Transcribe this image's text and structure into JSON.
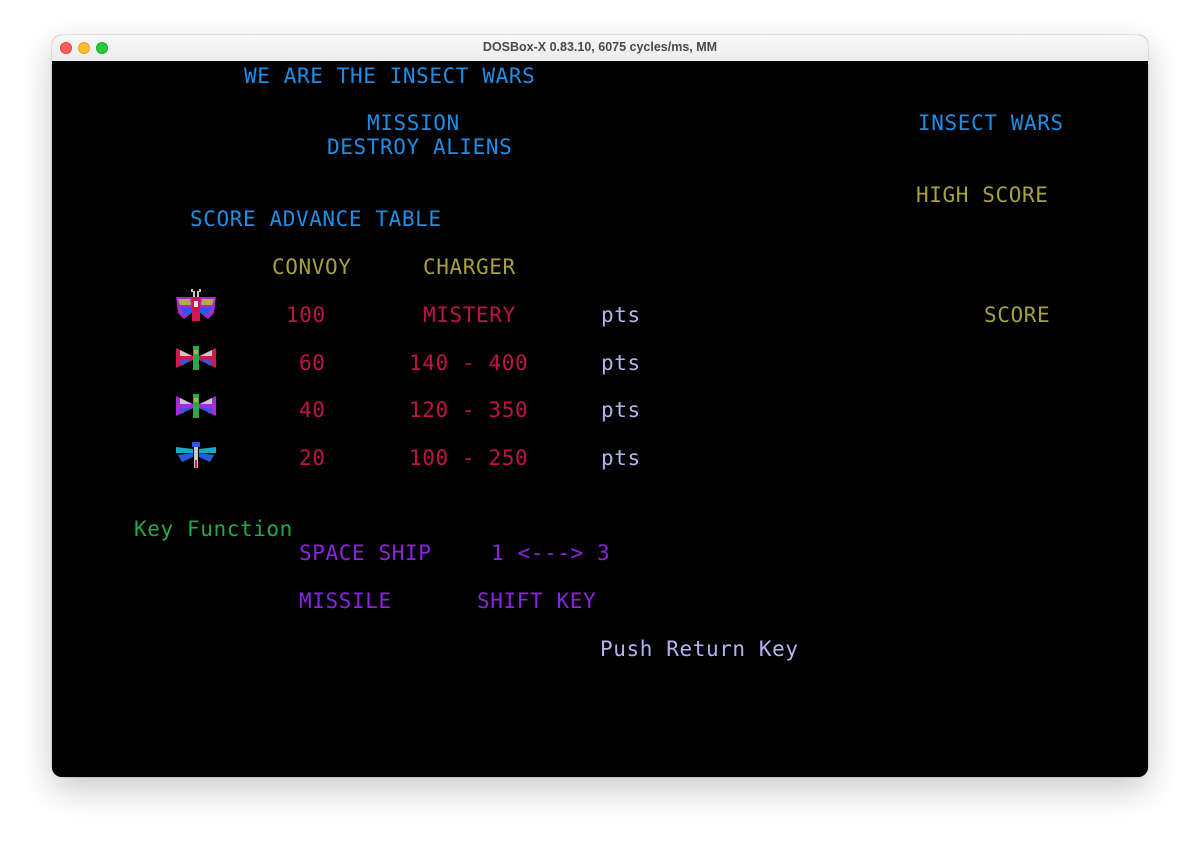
{
  "window": {
    "title": "DOSBox-X 0.83.10, 6075 cycles/ms, MM"
  },
  "screen": {
    "intro": "WE ARE THE INSECT WARS",
    "mission_heading": "MISSION",
    "mission_text": "DESTROY ALIENS",
    "game_name": "INSECT WARS",
    "high_score_label": "HIGH SCORE",
    "score_label": "SCORE",
    "score_table_title": "SCORE ADVANCE TABLE",
    "columns": {
      "convoy": "CONVOY",
      "charger": "CHARGER"
    },
    "rows": [
      {
        "insect": "flagship-insect-icon",
        "convoy": "100",
        "charger": "MISTERY",
        "unit": "pts"
      },
      {
        "insect": "red-moth-insect-icon",
        "convoy": "60",
        "charger": "140 - 400",
        "unit": "pts"
      },
      {
        "insect": "purple-moth-insect-icon",
        "convoy": "40",
        "charger": "120 - 350",
        "unit": "pts"
      },
      {
        "insect": "dragonfly-insect-icon",
        "convoy": "20",
        "charger": "100 - 250",
        "unit": "pts"
      }
    ],
    "key_function_title": "Key Function",
    "keys": [
      {
        "action": "SPACE SHIP",
        "binding": "1 <---> 3"
      },
      {
        "action": "MISSILE",
        "binding": "SHIFT KEY"
      }
    ],
    "prompt": "Push Return Key"
  },
  "colors": {
    "screen_bg": "#000000",
    "cyan_text": "#1e8fe6",
    "olive_text": "#a6a043",
    "crimson_text": "#c0124a",
    "lavender_text": "#b4b4ee",
    "green_text": "#26a84a",
    "purple_text": "#8a24e0"
  }
}
